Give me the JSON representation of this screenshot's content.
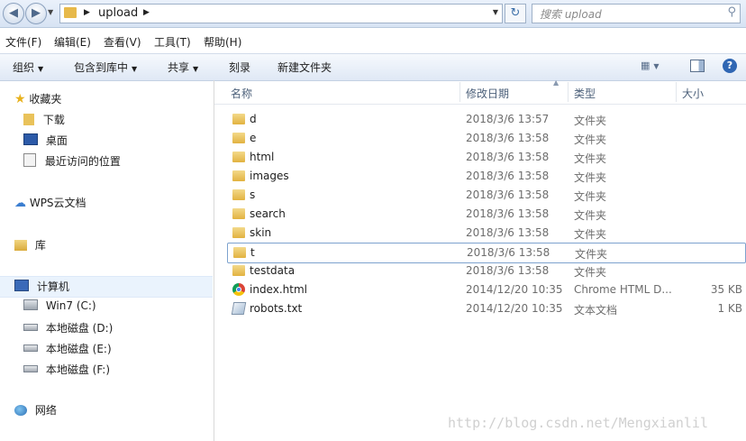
{
  "address": {
    "path": "upload",
    "search_placeholder": "搜索 upload"
  },
  "menu": [
    "文件(F)",
    "编辑(E)",
    "查看(V)",
    "工具(T)",
    "帮助(H)"
  ],
  "toolbar": {
    "organize": "组织",
    "include_in_library": "包含到库中",
    "share": "共享",
    "burn": "刻录",
    "new_folder": "新建文件夹"
  },
  "nav": {
    "favorites": "收藏夹",
    "downloads": "下载",
    "desktop": "桌面",
    "recent": "最近访问的位置",
    "wps": "WPS云文档",
    "libraries": "库",
    "computer": "计算机",
    "drive_c": "Win7 (C:)",
    "drive_d": "本地磁盘 (D:)",
    "drive_e": "本地磁盘 (E:)",
    "drive_f": "本地磁盘 (F:)",
    "network": "网络"
  },
  "columns": {
    "name": "名称",
    "modified": "修改日期",
    "type": "类型",
    "size": "大小"
  },
  "files": [
    {
      "name": "d",
      "date": "2018/3/6 13:57",
      "type": "文件夹",
      "size": "",
      "icon": "folder-icon"
    },
    {
      "name": "e",
      "date": "2018/3/6 13:58",
      "type": "文件夹",
      "size": "",
      "icon": "folder-icon"
    },
    {
      "name": "html",
      "date": "2018/3/6 13:58",
      "type": "文件夹",
      "size": "",
      "icon": "folder-icon"
    },
    {
      "name": "images",
      "date": "2018/3/6 13:58",
      "type": "文件夹",
      "size": "",
      "icon": "folder-icon"
    },
    {
      "name": "s",
      "date": "2018/3/6 13:58",
      "type": "文件夹",
      "size": "",
      "icon": "folder-icon"
    },
    {
      "name": "search",
      "date": "2018/3/6 13:58",
      "type": "文件夹",
      "size": "",
      "icon": "folder-icon"
    },
    {
      "name": "skin",
      "date": "2018/3/6 13:58",
      "type": "文件夹",
      "size": "",
      "icon": "folder-icon"
    },
    {
      "name": "t",
      "date": "2018/3/6 13:58",
      "type": "文件夹",
      "size": "",
      "icon": "folder-icon"
    },
    {
      "name": "testdata",
      "date": "2018/3/6 13:58",
      "type": "文件夹",
      "size": "",
      "icon": "folder-icon"
    },
    {
      "name": "index.html",
      "date": "2014/12/20 10:35",
      "type": "Chrome HTML D...",
      "size": "35 KB",
      "icon": "chrome-icon"
    },
    {
      "name": "robots.txt",
      "date": "2014/12/20 10:35",
      "type": "文本文档",
      "size": "1 KB",
      "icon": "text-file-icon"
    }
  ],
  "watermark": "http://blog.csdn.net/Mengxianlil",
  "colors": {
    "accent": "#3b6ea8",
    "folder": "#e2b240",
    "selection_border": "#7da2ce"
  }
}
